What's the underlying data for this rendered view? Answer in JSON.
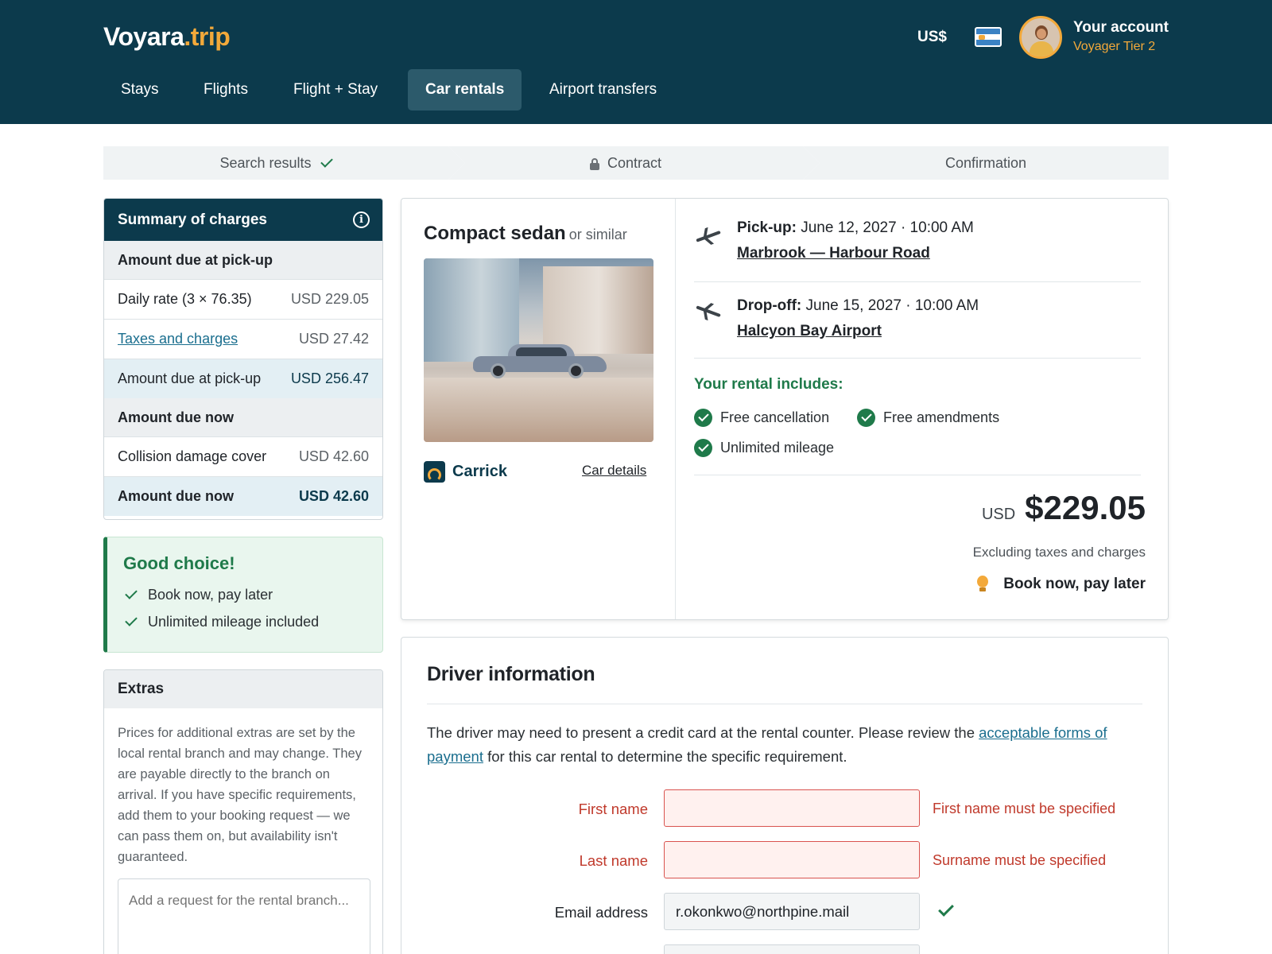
{
  "header": {
    "logo_main": "Voyara",
    "logo_accent": ".trip",
    "currency": "US$",
    "account_title": "Your account",
    "account_subtitle": "Voyager Tier 2",
    "nav": [
      {
        "label": "Stays"
      },
      {
        "label": "Flights"
      },
      {
        "label": "Flight + Stay"
      },
      {
        "label": "Car rentals",
        "active": true
      },
      {
        "label": "Airport transfers"
      }
    ]
  },
  "steps": [
    {
      "label": "Search results",
      "state": "done"
    },
    {
      "label": "Contract",
      "state": "current"
    },
    {
      "label": "Confirmation",
      "state": "upcoming"
    }
  ],
  "summary": {
    "title": "Summary of charges",
    "pickup_section": "Amount due at pick-up",
    "rows_pickup": [
      {
        "label": "Daily rate (3 × 76.35)",
        "amount": "USD 229.05"
      },
      {
        "label": "Taxes and charges",
        "amount": "USD 27.42"
      }
    ],
    "pickup_total_label": "Amount due at pick-up",
    "pickup_total_amount": "USD 256.47",
    "now_section": "Amount due now",
    "rows_now": [
      {
        "label": "Collision damage cover",
        "amount": "USD 42.60"
      }
    ],
    "now_total_label": "Amount due now",
    "now_total_amount": "USD 42.60"
  },
  "good_choice": {
    "title": "Good choice!",
    "items": [
      "Book now, pay later",
      "Unlimited mileage included"
    ]
  },
  "extras": {
    "title": "Extras",
    "text": "Prices for additional extras are set by the local rental branch and may change. They are payable directly to the branch on arrival. If you have specific requirements, add them to your booking request — we can pass them on, but availability isn't guaranteed.",
    "placeholder": "Add a request for the rental branch..."
  },
  "car": {
    "title": "Compact sedan",
    "similar": "or similar",
    "supplier": "Carrick",
    "details_link": "Car details",
    "pickup_label": "Pick-up:",
    "pickup_time": "June 12, 2027 · 10:00 AM",
    "pickup_location": "Marbrook — Harbour Road",
    "dropoff_label": "Drop-off:",
    "dropoff_time": "June 15, 2027 · 10:00 AM",
    "dropoff_location": "Halcyon Bay Airport",
    "includes_title": "Your rental includes:",
    "includes": [
      "Free cancellation",
      "Free amendments",
      "Unlimited mileage"
    ],
    "price_currency": "USD",
    "price_value": "$229.05",
    "price_note": "Excluding taxes and charges",
    "pay_later": "Book now, pay later"
  },
  "driver": {
    "title": "Driver information",
    "desc_before": "The driver may need to present a credit card at the rental counter. Please review the ",
    "desc_link": "acceptable forms of payment",
    "desc_after": " for this car rental to determine the specific requirement.",
    "first_name_label": "First name",
    "first_name_value": "",
    "first_name_error": "First name must be specified",
    "last_name_label": "Last name",
    "last_name_value": "",
    "last_name_error": "Surname must be specified",
    "email_label": "Email address",
    "email_value": "r.okonkwo@northpine.mail"
  },
  "colors": {
    "brand_dark": "#0c3a4c",
    "accent": "#f3a93a",
    "success": "#1f7a4a",
    "error": "#c0392b",
    "link": "#1a6e8e"
  },
  "icons": [
    "info-icon",
    "check-icon",
    "lock-icon",
    "plane-departure-icon",
    "plane-arrival-icon",
    "lightbulb-icon",
    "flag-icon",
    "avatar"
  ]
}
